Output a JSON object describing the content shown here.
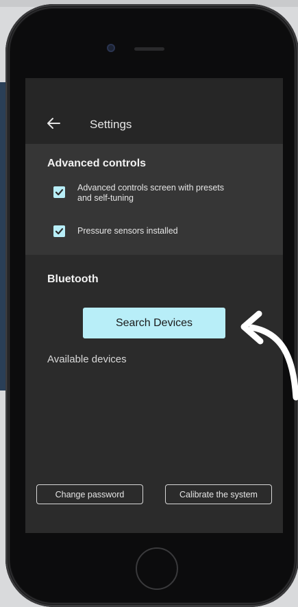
{
  "app_bar": {
    "title": "Settings",
    "back_icon": "arrow-left-icon"
  },
  "advanced_controls": {
    "heading": "Advanced controls",
    "options": [
      {
        "label": "Advanced controls screen with presets and self-tuning",
        "checked": true
      },
      {
        "label": "Pressure sensors installed",
        "checked": true
      }
    ]
  },
  "bluetooth": {
    "heading": "Bluetooth",
    "search_button": "Search Devices",
    "available_label": "Available devices"
  },
  "footer": {
    "change_password": "Change password",
    "calibrate": "Calibrate the system"
  },
  "colors": {
    "accent": "#b8eef8",
    "screen_bg": "#2b2b2b",
    "section_bg": "#363636"
  }
}
